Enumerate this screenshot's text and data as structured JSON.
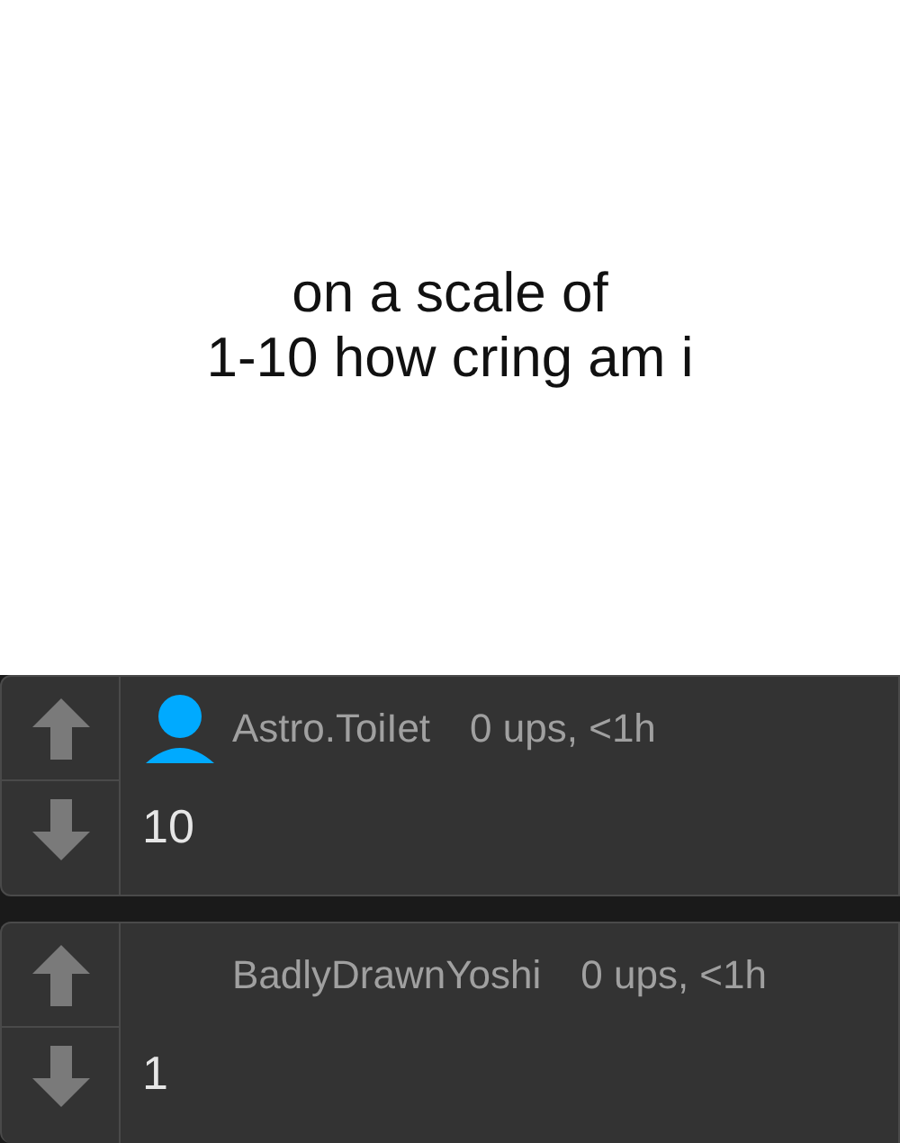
{
  "caption": "on a scale of\n1-10 how cring am i",
  "comments": [
    {
      "username": "Astro.ToiIet",
      "meta": "0 ups, <1h",
      "has_avatar": true,
      "text": "10"
    },
    {
      "username": "BadlyDrawnYoshi",
      "meta": "0 ups, <1h",
      "has_avatar": false,
      "text": "1"
    }
  ]
}
